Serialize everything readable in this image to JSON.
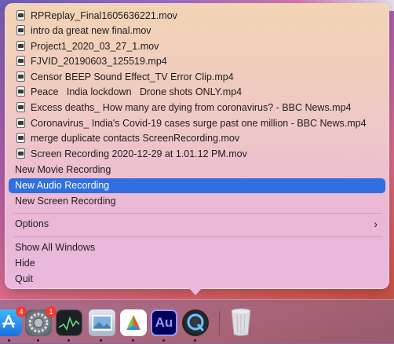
{
  "menu": {
    "recent_files": [
      "RPReplay_Final1605636221.mov",
      "intro da great new final.mov",
      "Project1_2020_03_27_1.mov",
      "FJVID_20190603_125519.mp4",
      "Censor BEEP Sound Effect_TV Error Clip.mp4",
      "Peace   India lockdown   Drone shots ONLY.mp4",
      "Excess deaths_ How many are dying from coronavirus? - BBC News.mp4",
      "Coronavirus_ India's Covid-19 cases surge past one million - BBC News.mp4",
      "merge duplicate contacts ScreenRecording.mov",
      "Screen Recording 2020-12-29 at 1.01.12 PM.mov"
    ],
    "new_movie": "New Movie Recording",
    "new_audio": "New Audio Recording",
    "new_screen": "New Screen Recording",
    "options": "Options",
    "options_chevron": "›",
    "show_all": "Show All Windows",
    "hide": "Hide",
    "quit": "Quit",
    "selected_item": "New Audio Recording",
    "accent_color": "#2f6fe0"
  },
  "dock": {
    "app_store_badge": "4",
    "system_prefs_badge": "1",
    "audition_label": "Au",
    "icons": [
      "app-store-icon",
      "system-preferences-icon",
      "activity-monitor-icon",
      "preview-icon",
      "affinity-icon",
      "adobe-audition-icon",
      "quicktime-icon",
      "trash-icon"
    ]
  }
}
